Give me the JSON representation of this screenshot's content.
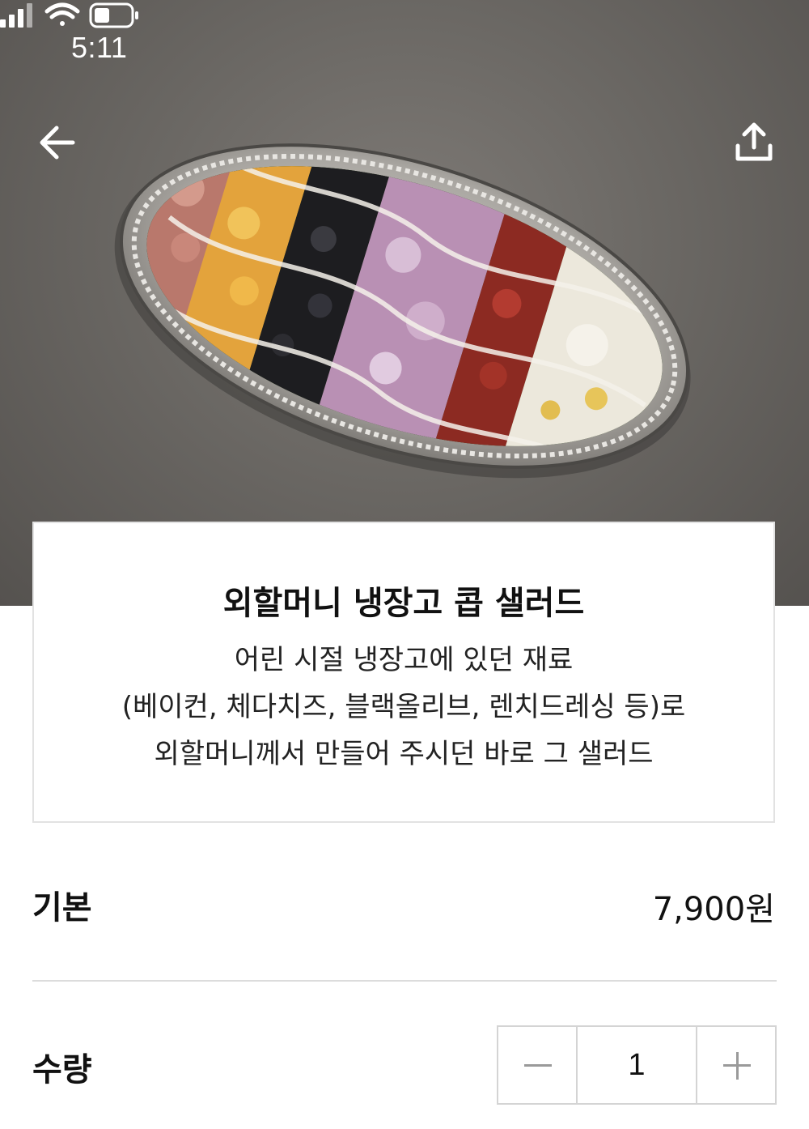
{
  "status_bar": {
    "time": "5:11",
    "icons": [
      "cellular-signal-icon",
      "wifi-icon",
      "battery-icon"
    ]
  },
  "header": {
    "back_icon": "arrow-left-icon",
    "share_icon": "share-upload-icon"
  },
  "product": {
    "title": "외할머니 냉장고 콥 샐러드",
    "description_lines": [
      "어린 시절 냉장고에 있던 재료",
      "(베이컨, 체다치즈, 블랙올리브, 렌치드레싱 등)로",
      "외할머니께서 만들어 주시던 바로 그 샐러드"
    ]
  },
  "options": {
    "base_label": "기본",
    "base_price": "7,900원",
    "quantity_label": "수량",
    "quantity_value": "1"
  },
  "colors": {
    "photo_background": "#6b6864",
    "divider": "#dcdcdc",
    "stepper_border": "#d4d4d4",
    "text": "#111111"
  }
}
